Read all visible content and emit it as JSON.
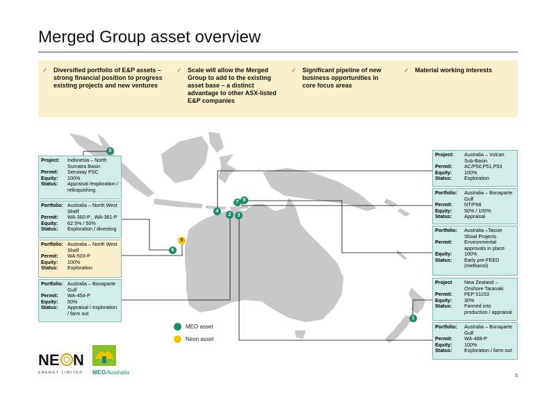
{
  "title": "Merged Group asset overview",
  "bullets": [
    "Diversified portfolio of E&P assets – strong financial position to progress existing projects and new ventures",
    "Scale will allow the Merged Group to add to the existing asset base – a distinct advantage to other ASX-listed E&P companies",
    "Significant pipeline of new business opportunities in core focus areas",
    "Material working interests"
  ],
  "check_glyph": "✓",
  "left_boxes": {
    "b5": {
      "k1": "Project:",
      "v1": "Indonesia – North Sumatra Basin",
      "k2": "Permit:",
      "v2": "Seruway PSC",
      "k3": "Equity:",
      "v3": "100%",
      "k4": "Status:",
      "v4": "Appraisal /exploration / relinquishing"
    },
    "b2": {
      "k1": "Portfolio:",
      "v1": "Australia – North West Shelf",
      "k2": "Permit:",
      "v2": "WA-360-P , WA-361-P",
      "k3": "Equity:",
      "v3": "62.5% / 50%",
      "k4": "Status:",
      "v4": "Exploration / divesting"
    },
    "b9": {
      "k1": "Portfolio:",
      "v1": "Australia – North West Shelf",
      "k2": "Permit:",
      "v2": "WA-503-P",
      "k3": "Equity:",
      "v3": "100%",
      "k4": "Status:",
      "v4": "Exploration"
    },
    "b3": {
      "k1": "Portfolio:",
      "v1": "Australia – Bonaparte Gulf",
      "k2": "Permit:",
      "v2": "WA-454-P",
      "k3": "Equity:",
      "v3": "50%",
      "k4": "Status:",
      "v4": "Appraisal / exploration / farm out"
    }
  },
  "right_boxes": {
    "b4": {
      "k1": "Project:",
      "v1": "Australia – Vulcan Sub-Basin",
      "k2": "Permit:",
      "v2": "AC/P50,P51,P53",
      "k3": "Equity:",
      "v3": "100%",
      "k4": "Status:",
      "v4": "Exploration"
    },
    "b7": {
      "k1": "Portfolio:",
      "v1": "Australia – Bonaparte Gulf",
      "k2": "Permit:",
      "v2": "NT/P68",
      "k3": "Equity:",
      "v3": "50% / 100%",
      "k4": "Status:",
      "v4": "Appraisal"
    },
    "b8": {
      "k1": "Portfolio:",
      "v1": "Australia –Tassie Shoal Projects",
      "k2": "Permit:",
      "v2": "Environmental approvals in place",
      "k3": "Equity:",
      "v3": "100%",
      "k4": "Status:",
      "v4": "Early pre-FEED (methanol)"
    },
    "b1": {
      "k1": "Project",
      "v1": "New Zealand – Onshore Taranaki",
      "k2": "Permit:",
      "v2": "PEP 51153",
      "k3": "Equity:",
      "v3": "30%",
      "k4": "Status:",
      "v4": "Farmed into production / appraisal"
    },
    "b6": {
      "k1": "Portfolio:",
      "v1": "Australia – Bonaparte Gulf",
      "k2": "Permit:",
      "v2": "WA-488-P",
      "k3": "Equity:",
      "v3": "100%",
      "k4": "Status:",
      "v4": "Exploration / farm out"
    }
  },
  "markers": {
    "m1": "1",
    "m2": "2",
    "m3": "3",
    "m4": "4",
    "m5": "5",
    "m6": "6",
    "m7": "7",
    "m8": "8",
    "m9": "9"
  },
  "legend": {
    "meo": "MEO asset",
    "neon": "Neon asset"
  },
  "colors": {
    "meo": "#1b8a6f",
    "neon": "#f2c500",
    "box_teal": "#d2ece7",
    "box_yellow": "#faf0cc"
  },
  "logos": {
    "neon_main": "NE N",
    "neon_sub": "ENERGY LIMITED",
    "meo_text": "MEOAustralia"
  },
  "page_number": "5"
}
